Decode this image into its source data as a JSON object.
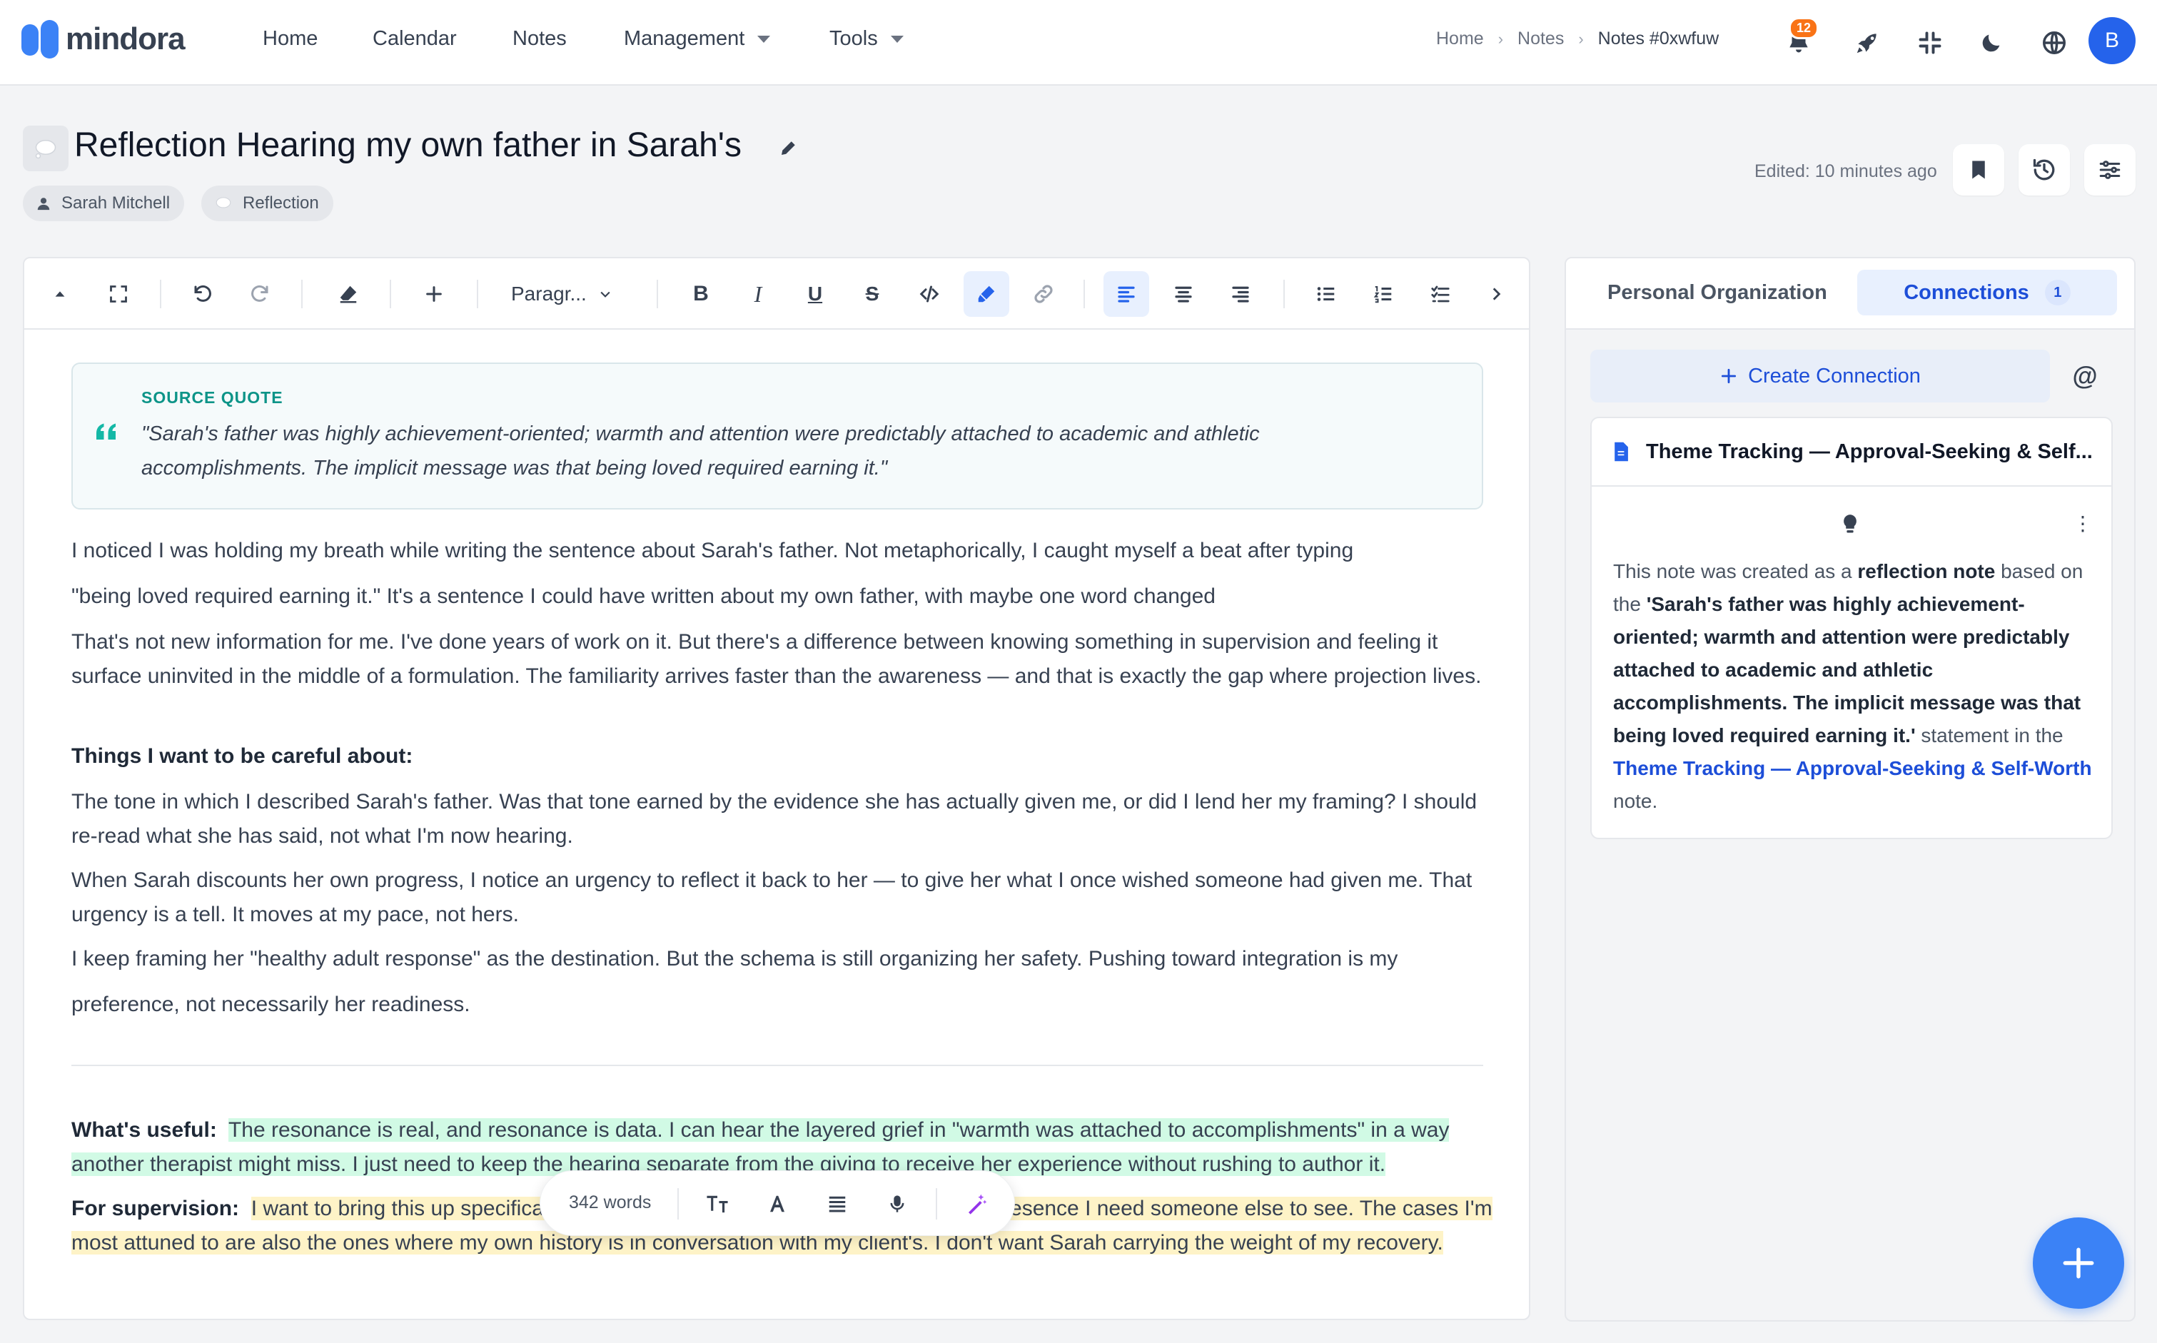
{
  "app": {
    "name": "mindora"
  },
  "nav": {
    "items": [
      "Home",
      "Calendar",
      "Notes",
      "Management",
      "Tools"
    ]
  },
  "breadcrumb": [
    "Home",
    "Notes",
    "Notes #0xwfuw"
  ],
  "notifications": {
    "count": "12"
  },
  "user": {
    "initial": "B"
  },
  "note": {
    "title": "Reflection Hearing my own father in Sarah's",
    "tags": [
      "Sarah Mitchell",
      "Reflection"
    ],
    "edited": "Edited: 10 minutes ago"
  },
  "toolbar": {
    "block_type": "Paragr..."
  },
  "source_quote": {
    "label": "SOURCE QUOTE",
    "text": "\"Sarah's father was highly achievement-oriented; warmth and attention were predictably attached to academic and athletic accomplishments. The implicit message was that being loved required earning it.\""
  },
  "body": {
    "p1": "I noticed I was holding my breath while writing the sentence about Sarah's father. Not metaphorically, I caught myself a beat after typing",
    "p2": "\"being loved required earning it.\" It's a sentence I could have written about my own father, with maybe one word changed",
    "p3": "That's not new information for me. I've done years of work on it. But there's a difference between knowing something in supervision and feeling it surface uninvited in the middle of a formulation. The familiarity arrives faster than the awareness — and that is exactly the gap where projection lives.",
    "h1": "Things I want to be careful about:",
    "p4": "The tone in which I described Sarah's father. Was that tone earned by the evidence she has actually given me, or did I lend her my framing? I should re-read what she has said, not what I'm now hearing.",
    "p5": "When Sarah discounts her own progress, I notice an urgency to reflect it back to her — to give her what I once wished someone had given me. That urgency is a tell. It moves at my pace, not hers.",
    "p6a": "I keep framing her \"healthy adult response\" as the destination. But the schema is still organizing her safety. Pushing toward integration is my",
    "p6b": "preference, not necessarily her readiness.",
    "useful_label": "What's useful:",
    "useful_text": "The resonance is real, and resonance is data. I can hear the layered grief in \"warmth was attached to accomplishments\" in a way another therapist might miss. I just need to keep the hearing separate from the giving to receive her experience without rushing to author it.",
    "supervision_label": "For supervision:",
    "supervision_text": "I want to bring this up specifically. Not as a problem to solve, but as a working presence I need someone else to see. The cases I'm most attuned to are also the ones where my own history is in conversation with my client's. I don't want Sarah carrying the weight of my recovery."
  },
  "float_bar": {
    "words": "342 words"
  },
  "panel": {
    "tab_org": "Personal Organization",
    "tab_connections": "Connections",
    "connections_count": "1",
    "create_label": "Create Connection",
    "at_symbol": "@",
    "card_title": "Theme Tracking — Approval-Seeking & Self...",
    "desc_1": "This note was created as a ",
    "desc_2": "reflection note",
    "desc_3": " based on the ",
    "desc_4": "'Sarah's father was highly achievement-oriented; warmth and attention were predictably attached to academic and athletic accomplishments. The implicit message was that being loved required earning it.'",
    "desc_5": " statement in the ",
    "desc_link": "Theme Tracking — Approval-Seeking & Self-Worth",
    "desc_6": " note."
  },
  "colors": {
    "brand": "#3b82f6",
    "accent_text": "#1d4ed8",
    "highlight_green": "#d1fae5",
    "highlight_yellow": "#fef3c7",
    "quote_label": "#0d9488",
    "badge": "#f97316"
  },
  "icons": {
    "nav": [
      "bell-icon",
      "rocket-icon",
      "compress-icon",
      "moon-icon",
      "globe-icon"
    ],
    "toolbar": [
      "chevron-up-icon",
      "fullscreen-icon",
      "undo-icon",
      "redo-icon",
      "eraser-icon",
      "plus-icon",
      "bold-icon",
      "italic-icon",
      "underline-icon",
      "strikethrough-icon",
      "code-icon",
      "highlighter-icon",
      "link-icon",
      "align-left-icon",
      "align-center-icon",
      "align-right-icon",
      "bullet-list-icon",
      "ordered-list-icon",
      "task-list-icon",
      "chevron-right-icon"
    ]
  }
}
